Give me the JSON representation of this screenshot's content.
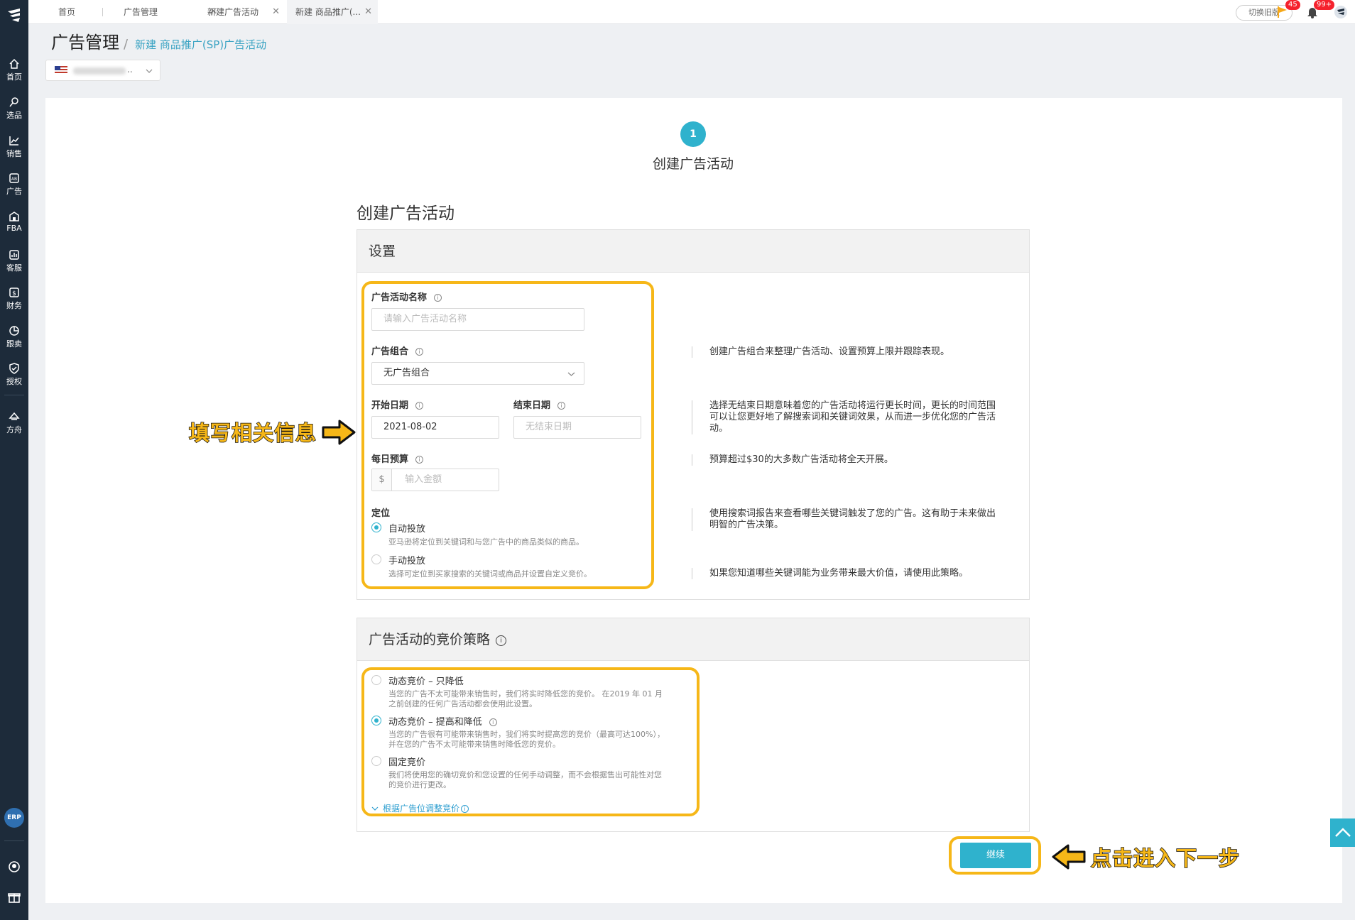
{
  "sidebar": {
    "items": [
      {
        "label": "首页",
        "icon": "home-icon"
      },
      {
        "label": "选品",
        "icon": "search-icon"
      },
      {
        "label": "销售",
        "icon": "chart-line-icon"
      },
      {
        "label": "广告",
        "icon": "ad-icon"
      },
      {
        "label": "FBA",
        "icon": "warehouse-icon"
      },
      {
        "label": "客服",
        "icon": "service-icon"
      },
      {
        "label": "财务",
        "icon": "finance-icon"
      },
      {
        "label": "跟卖",
        "icon": "pie-icon"
      },
      {
        "label": "授权",
        "icon": "shield-icon"
      },
      {
        "label": "方舟",
        "icon": "ark-icon"
      }
    ],
    "erp_label": "ERP"
  },
  "tabs": [
    {
      "label": "首页",
      "closable": false
    },
    {
      "label": "广告管理",
      "closable": true
    },
    {
      "label": "新建广告活动",
      "closable": true
    },
    {
      "label": "新建 商品推广(...",
      "closable": true,
      "active": true
    }
  ],
  "topbar": {
    "old_version_label": "切换旧版",
    "flag_badge": "45",
    "bell_badge": "99+"
  },
  "breadcrumb": {
    "title": "广告管理",
    "separator": "/",
    "current": "新建 商品推广(SP)广告活动"
  },
  "store_selector": {
    "value": ".."
  },
  "step": {
    "number": "1",
    "label": "创建广告活动"
  },
  "page_title": "创建广告活动",
  "settings": {
    "header": "设置",
    "campaign_name": {
      "label": "广告活动名称",
      "placeholder": "请输入广告活动名称"
    },
    "portfolio": {
      "label": "广告组合",
      "value": "无广告组合"
    },
    "start_date": {
      "label": "开始日期",
      "value": "2021-08-02"
    },
    "end_date": {
      "label": "结束日期",
      "placeholder": "无结束日期"
    },
    "budget": {
      "label": "每日预算",
      "currency": "$",
      "placeholder": "输入金额"
    },
    "targeting": {
      "label": "定位",
      "options": [
        {
          "label": "自动投放",
          "desc": "亚马逊将定位到关键词和与您广告中的商品类似的商品。",
          "selected": true
        },
        {
          "label": "手动投放",
          "desc": "选择可定位到买家搜索的关键词或商品并设置自定义竞价。",
          "selected": false
        }
      ]
    },
    "side_descriptions": {
      "portfolio": "创建广告组合来整理广告活动、设置预算上限并跟踪表现。",
      "dates": "选择无结束日期意味着您的广告活动将运行更长时间，更长的时间范围可以让您更好地了解搜索词和关键词效果，从而进一步优化您的广告活动。",
      "budget": "预算超过$30的大多数广告活动将全天开展。",
      "auto": "使用搜索词报告来查看哪些关键词触发了您的广告。这有助于未来做出明智的广告决策。",
      "manual": "如果您知道哪些关键词能为业务带来最大价值，请使用此策略。"
    }
  },
  "bidding": {
    "header": "广告活动的竞价策略",
    "options": [
      {
        "label": "动态竞价 – 只降低",
        "desc1": "当您的广告不太可能带来销售时，我们将实时降低您的竞价。 在2019 年 01 月",
        "desc2": "之前创建的任何广告活动都会使用此设置。",
        "selected": false
      },
      {
        "label": "动态竞价 – 提高和降低",
        "desc1": "当您的广告很有可能带来销售时，我们将实时提高您的竞价（最高可达100%），",
        "desc2": "并在您的广告不太可能带来销售时降低您的竞价。",
        "selected": true
      },
      {
        "label": "固定竞价",
        "desc1": "我们将使用您的确切竞价和您设置的任何手动调整，而不会根据售出可能性对您",
        "desc2": "的竞价进行更改。",
        "selected": false
      }
    ],
    "adjust_link": "根据广告位调整竞价"
  },
  "continue_label": "继续",
  "annotations": {
    "fill_info": "填写相关信息",
    "next_step": "点击进入下一步"
  },
  "colors": {
    "accent": "#2fb2cd",
    "highlight": "#f6b718",
    "sidebar": "#1d2b3a"
  }
}
